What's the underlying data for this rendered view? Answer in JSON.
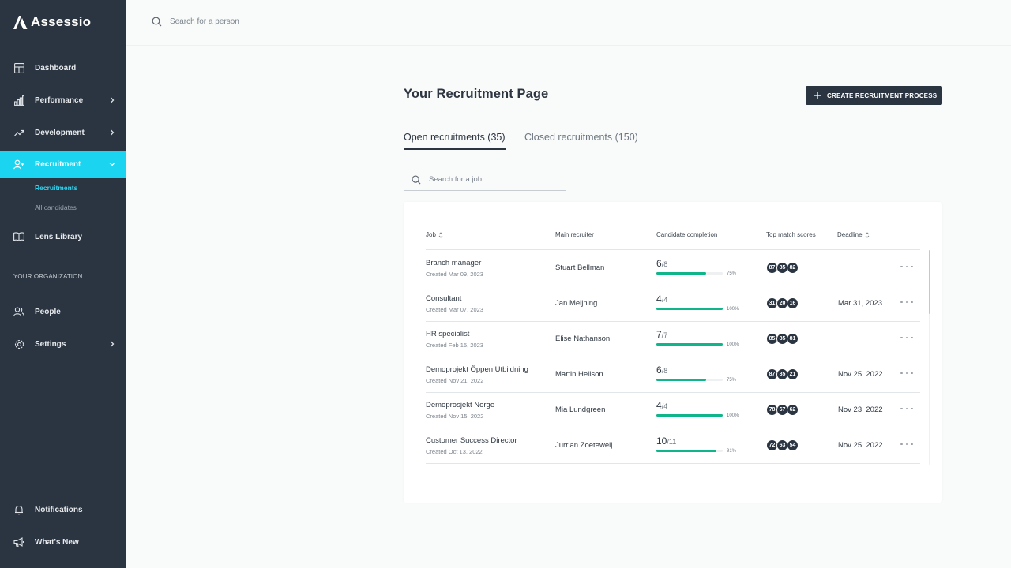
{
  "brand": {
    "name": "Assessio"
  },
  "colors": {
    "sidebar": "#2b3541",
    "accent": "#1ad4f0",
    "progress": "#10b58a",
    "badge": "#2b3541"
  },
  "sidebar": {
    "items": [
      {
        "label": "Dashboard",
        "icon": "dashboard-icon"
      },
      {
        "label": "Performance",
        "icon": "bar-chart-icon"
      },
      {
        "label": "Development",
        "icon": "trending-up-icon"
      },
      {
        "label": "Recruitment",
        "icon": "add-user-icon",
        "active": true
      },
      {
        "label": "Lens Library",
        "icon": "book-icon"
      }
    ],
    "recruitment_sub": [
      {
        "label": "Recruitments",
        "active": true
      },
      {
        "label": "All candidates"
      }
    ],
    "section_label": "YOUR ORGANIZATION",
    "org_items": [
      {
        "label": "People",
        "icon": "people-icon"
      },
      {
        "label": "Settings",
        "icon": "gear-icon"
      }
    ],
    "bottom_items": [
      {
        "label": "Notifications",
        "icon": "bell-icon"
      },
      {
        "label": "What's New",
        "icon": "megaphone-icon"
      }
    ]
  },
  "topbar": {
    "search_placeholder": "Search for a person"
  },
  "main": {
    "title": "Your Recruitment Page",
    "create_button": "CREATE RECRUITMENT PROCESS",
    "tabs": [
      {
        "label": "Open recruitments (35)",
        "active": true
      },
      {
        "label": "Closed recruitments (150)"
      }
    ],
    "job_search_placeholder": "Search for a job"
  },
  "table": {
    "headers": [
      "Job",
      "Main recruiter",
      "Candidate completion",
      "Top match scores",
      "Deadline"
    ],
    "rows": [
      {
        "job": "Branch manager",
        "created": "Created Mar 09, 2023",
        "recruiter": "Stuart Bellman",
        "done": "6",
        "total": "/8",
        "pct_label": "75%",
        "progress": 0.75,
        "scores": [
          "87",
          "85",
          "82"
        ],
        "deadline": ""
      },
      {
        "job": "Consultant",
        "created": "Created Mar 07, 2023",
        "recruiter": "Jan Meijning",
        "done": "4",
        "total": "/4",
        "pct_label": "100%",
        "progress": 1.0,
        "scores": [
          "31",
          "20",
          "16"
        ],
        "deadline": "Mar 31, 2023"
      },
      {
        "job": "HR specialist",
        "created": "Created Feb 15, 2023",
        "recruiter": "Elise Nathanson",
        "done": "7",
        "total": "/7",
        "pct_label": "100%",
        "progress": 1.0,
        "scores": [
          "85",
          "85",
          "81"
        ],
        "deadline": ""
      },
      {
        "job": "Demoprojekt Öppen Utbildning",
        "created": "Created Nov 21, 2022",
        "recruiter": "Martin Hellson",
        "done": "6",
        "total": "/8",
        "pct_label": "75%",
        "progress": 0.75,
        "scores": [
          "87",
          "85",
          "21"
        ],
        "deadline": "Nov 25, 2022"
      },
      {
        "job": "Demoprosjekt Norge",
        "created": "Created Nov 15, 2022",
        "recruiter": "Mia Lundgreen",
        "done": "4",
        "total": "/4",
        "pct_label": "100%",
        "progress": 1.0,
        "scores": [
          "78",
          "67",
          "62"
        ],
        "deadline": "Nov 23, 2022"
      },
      {
        "job": "Customer Success Director",
        "created": "Created Oct 13, 2022",
        "recruiter": "Jurrian Zoeteweij",
        "done": "10",
        "total": "/11",
        "pct_label": "91%",
        "progress": 0.91,
        "scores": [
          "72",
          "63",
          "54"
        ],
        "deadline": "Nov 25, 2022"
      }
    ]
  }
}
